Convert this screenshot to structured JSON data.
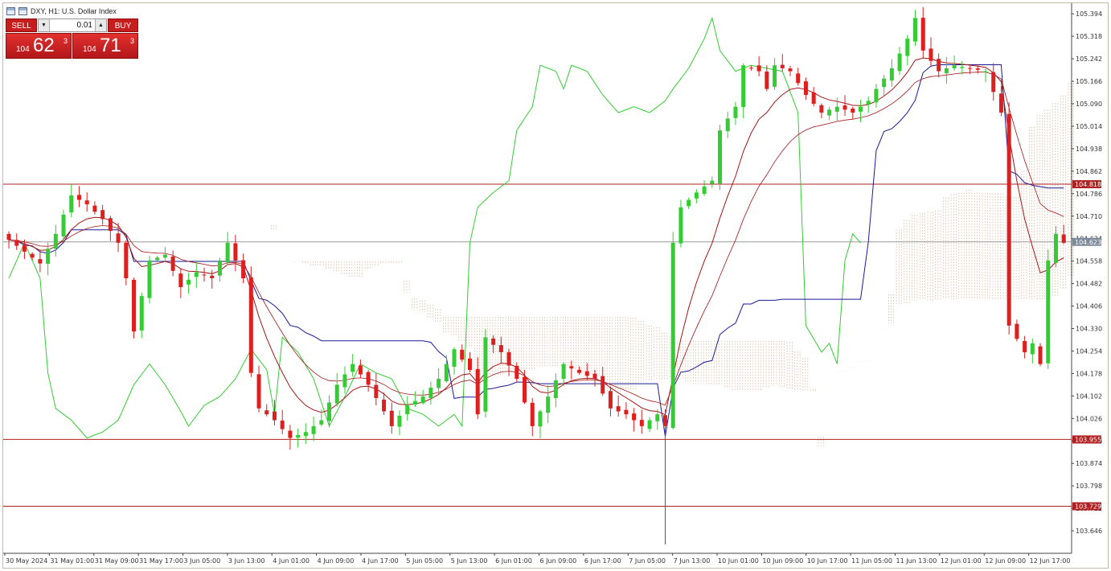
{
  "header": {
    "title": "DXY, H1: U.S. Dollar Index"
  },
  "trade_panel": {
    "sell_label": "SELL",
    "buy_label": "BUY",
    "lot_value": "0.01",
    "sell_price": {
      "big": "104",
      "main": "62",
      "sup": "3"
    },
    "buy_price": {
      "big": "104",
      "main": "71",
      "sup": "3"
    }
  },
  "colors": {
    "bull": "#33cc33",
    "bear": "#dd1f1f",
    "chikou": "#33cc33",
    "kijun": "#1a1a99",
    "ma": "#a31515",
    "cloud": "#c8a07a",
    "level_line": "#b02020",
    "bid_line": "#9a9a9a"
  },
  "chart_data": {
    "type": "candlestick",
    "symbol": "DXY",
    "timeframe": "H1",
    "ylim": [
      103.57,
      105.43
    ],
    "y_ticks": [
      "105.394",
      "105.318",
      "105.242",
      "105.166",
      "105.090",
      "105.014",
      "104.938",
      "104.862",
      "104.786",
      "104.710",
      "104.634",
      "104.558",
      "104.482",
      "104.406",
      "104.330",
      "104.254",
      "104.178",
      "104.102",
      "104.026",
      "103.950",
      "103.874",
      "103.798",
      "103.722",
      "103.646"
    ],
    "x_ticks": [
      "30 May 2024",
      "31 May 01:00",
      "31 May 09:00",
      "31 May 17:00",
      "3 Jun 05:00",
      "3 Jun 13:00",
      "4 Jun 01:00",
      "4 Jun 09:00",
      "4 Jun 17:00",
      "5 Jun 05:00",
      "5 Jun 13:00",
      "6 Jun 01:00",
      "6 Jun 09:00",
      "6 Jun 17:00",
      "7 Jun 05:00",
      "7 Jun 13:00",
      "10 Jun 01:00",
      "10 Jun 09:00",
      "10 Jun 17:00",
      "11 Jun 05:00",
      "11 Jun 13:00",
      "12 Jun 01:00",
      "12 Jun 09:00",
      "12 Jun 17:00"
    ],
    "level_lines": [
      {
        "value": 104.818,
        "label": "104.818"
      },
      {
        "value": 103.955,
        "label": "103.955"
      },
      {
        "value": 103.729,
        "label": "103.729"
      }
    ],
    "bid": {
      "value": 104.623,
      "label": "104.623"
    },
    "anchors": [
      [
        0,
        104.63
      ],
      [
        4,
        104.55
      ],
      [
        6,
        104.65
      ],
      [
        8,
        104.78
      ],
      [
        10,
        104.75
      ],
      [
        12,
        104.7
      ],
      [
        14,
        104.62
      ],
      [
        15,
        104.5
      ],
      [
        16,
        104.32
      ],
      [
        17,
        104.44
      ],
      [
        18,
        104.56
      ],
      [
        20,
        104.58
      ],
      [
        22,
        104.47
      ],
      [
        24,
        104.52
      ],
      [
        26,
        104.5
      ],
      [
        28,
        104.62
      ],
      [
        29,
        104.56
      ],
      [
        30,
        104.5
      ],
      [
        31,
        104.18
      ],
      [
        32,
        104.06
      ],
      [
        34,
        104.02
      ],
      [
        36,
        103.96
      ],
      [
        38,
        103.98
      ],
      [
        40,
        104.02
      ],
      [
        42,
        104.14
      ],
      [
        44,
        104.21
      ],
      [
        46,
        104.14
      ],
      [
        48,
        104.05
      ],
      [
        49,
        104.0
      ],
      [
        51,
        104.07
      ],
      [
        53,
        104.1
      ],
      [
        55,
        104.16
      ],
      [
        57,
        104.26
      ],
      [
        59,
        104.19
      ],
      [
        60,
        104.04
      ],
      [
        61,
        104.3
      ],
      [
        63,
        104.25
      ],
      [
        65,
        104.16
      ],
      [
        67,
        104.0
      ],
      [
        69,
        104.1
      ],
      [
        71,
        104.21
      ],
      [
        73,
        104.18
      ],
      [
        75,
        104.16
      ],
      [
        77,
        104.06
      ],
      [
        79,
        104.04
      ],
      [
        81,
        104.0
      ],
      [
        83,
        104.04
      ],
      [
        84,
        104.0
      ],
      [
        85,
        104.62
      ],
      [
        86,
        104.74
      ],
      [
        88,
        104.79
      ],
      [
        90,
        104.83
      ],
      [
        91,
        105.0
      ],
      [
        93,
        105.08
      ],
      [
        94,
        105.22
      ],
      [
        96,
        105.2
      ],
      [
        97,
        105.14
      ],
      [
        98,
        105.22
      ],
      [
        100,
        105.2
      ],
      [
        102,
        105.12
      ],
      [
        104,
        105.06
      ],
      [
        106,
        105.08
      ],
      [
        108,
        105.06
      ],
      [
        110,
        105.1
      ],
      [
        111,
        105.14
      ],
      [
        113,
        105.21
      ],
      [
        115,
        105.31
      ],
      [
        116,
        105.38
      ],
      [
        117,
        105.27
      ],
      [
        119,
        105.2
      ],
      [
        121,
        105.22
      ],
      [
        123,
        105.21
      ],
      [
        125,
        105.2
      ],
      [
        127,
        105.06
      ],
      [
        128,
        104.34
      ],
      [
        130,
        104.25
      ],
      [
        131,
        104.28
      ],
      [
        132,
        104.21
      ],
      [
        133,
        104.56
      ],
      [
        134,
        104.65
      ],
      [
        135,
        104.62
      ]
    ]
  }
}
